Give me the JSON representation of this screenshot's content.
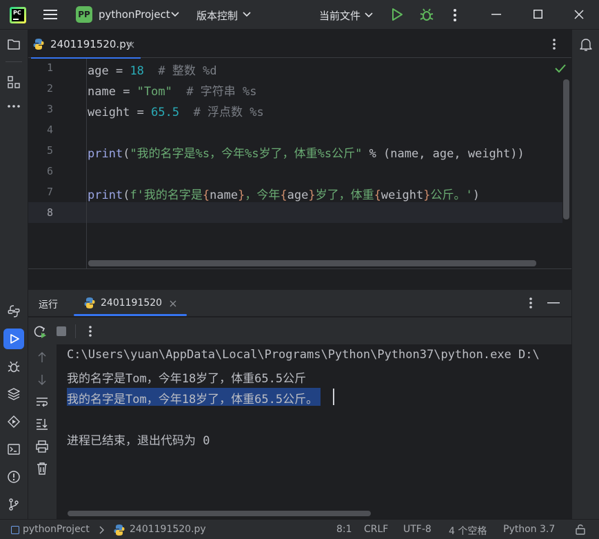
{
  "titlebar": {
    "project_badge": "PP",
    "project_name": "pythonProject",
    "vcs_label": "版本控制",
    "run_config": "当前文件"
  },
  "editor": {
    "tab_name": "2401191520.py",
    "line_numbers": [
      "1",
      "2",
      "3",
      "4",
      "5",
      "6",
      "7",
      "8"
    ],
    "lines": {
      "l1": {
        "var": "age",
        "op": " = ",
        "val": "18",
        "comment": "  # 整数 %d"
      },
      "l2": {
        "var": "name",
        "op": " = ",
        "val": "\"Tom\"",
        "comment": "  # 字符串 %s"
      },
      "l3": {
        "var": "weight",
        "op": " = ",
        "val": "65.5",
        "comment": "  # 浮点数 %s"
      },
      "l5": {
        "fn": "print",
        "open": "(",
        "str": "\"我的名字是%s，今年%s岁了，体重%s公斤\"",
        "rest": " % (name, age, weight))"
      },
      "l7": {
        "fn": "print",
        "open": "(",
        "s1": "f'我的名字是",
        "b1": "{",
        "v1": "name",
        "b2": "}",
        "s2": "，今年",
        "b3": "{",
        "v2": "age",
        "b4": "}",
        "s3": "岁了，体重",
        "b5": "{",
        "v3": "weight",
        "b6": "}",
        "s4": "公斤。'",
        "close": ")"
      }
    }
  },
  "run_panel": {
    "run_label": "运行",
    "tab_name": "2401191520",
    "console": [
      "C:\\Users\\yuan\\AppData\\Local\\Programs\\Python\\Python37\\python.exe D:\\",
      "我的名字是Tom，今年18岁了，体重65.5公斤",
      "我的名字是Tom，今年18岁了，体重65.5公斤。",
      "",
      "进程已结束，退出代码为 0"
    ]
  },
  "statusbar": {
    "breadcrumb_project": "pythonProject",
    "breadcrumb_file": "2401191520.py",
    "position": "8:1",
    "line_sep": "CRLF",
    "encoding": "UTF-8",
    "indent": "4 个空格",
    "interpreter": "Python 3.7"
  },
  "colors": {
    "accent": "#3574f0",
    "run_green": "#5fb85c",
    "selection": "#214283"
  }
}
